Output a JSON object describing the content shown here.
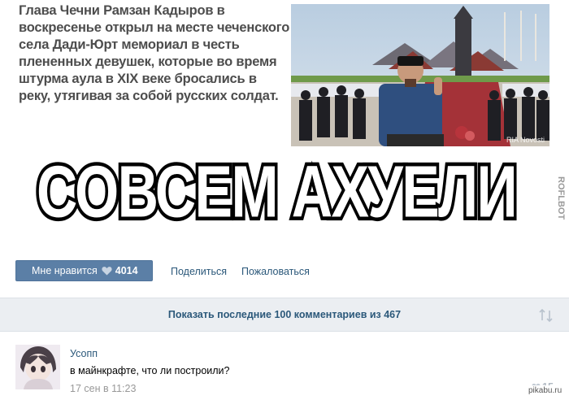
{
  "meme": {
    "news_text": "Глава Чечни Рамзан Кадыров в воскресенье открыл на месте чеченского села Дади-Юрт мемориал в честь плененных девушек, которые во время штурма аула в XIX веке бросались в реку, утягивая за собой русских солдат.",
    "photo_credit": "RIA Novosti",
    "caption": "СОВСЕМ АХУЕЛИ",
    "watermark": "ROFLBOT"
  },
  "actions": {
    "like_label": "Мне нравится",
    "like_count": "4014",
    "share_label": "Поделиться",
    "report_label": "Пожаловаться"
  },
  "comments_bar": {
    "label": "Показать последние 100 комментариев из 467"
  },
  "comment": {
    "author": "Усопп",
    "text": "в майнкрафте, что ли построили?",
    "time": "17 сен в 11:23",
    "likes": "15"
  },
  "site_mark": "pikabu.ru",
  "colors": {
    "vk_blue": "#5b7fa6",
    "link": "#2b587a",
    "bar_bg": "#ebeef2"
  }
}
